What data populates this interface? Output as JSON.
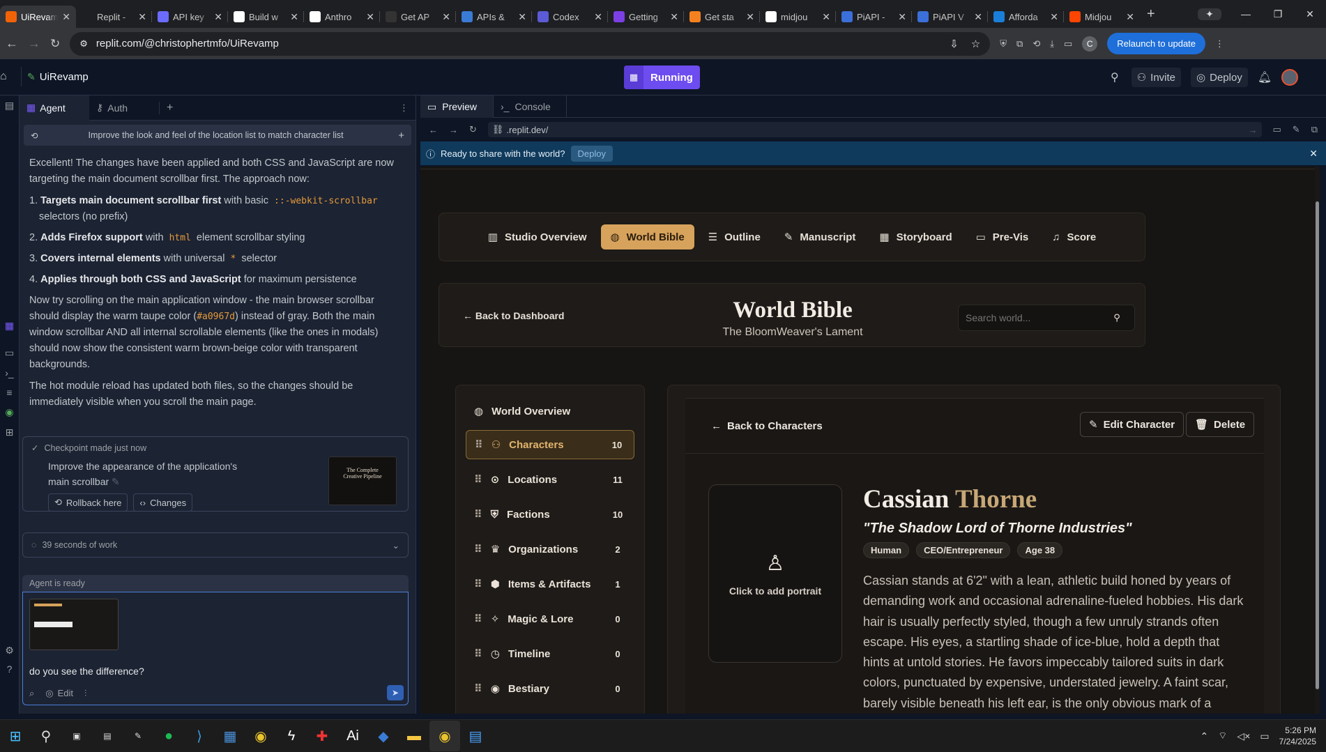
{
  "browser": {
    "tabs": [
      {
        "label": "UiRevamp",
        "icon": "replit-icon",
        "color": "#f26207",
        "active": true
      },
      {
        "label": "Replit - ",
        "icon": "replit-icon",
        "color": "#1e1f22"
      },
      {
        "label": "API key",
        "icon": "openai-icon",
        "color": "#6b6bff"
      },
      {
        "label": "Build w",
        "icon": "anthropic-icon",
        "color": "#ffffff"
      },
      {
        "label": "Anthro",
        "icon": "anthropic-icon",
        "color": "#ffffff"
      },
      {
        "label": "Get AP",
        "icon": "terminal-icon",
        "color": "#333333"
      },
      {
        "label": "APIs &",
        "icon": "api-icon",
        "color": "#3a7bd5"
      },
      {
        "label": "Codex",
        "icon": "codex-icon",
        "color": "#5b5bd6"
      },
      {
        "label": "Getting",
        "icon": "plus-icon",
        "color": "#7b3fe4"
      },
      {
        "label": "Get sta",
        "icon": "cloud-icon",
        "color": "#f48120"
      },
      {
        "label": "midjou",
        "icon": "google-icon",
        "color": "#ffffff"
      },
      {
        "label": "PiAPI - ",
        "icon": "piapi-icon",
        "color": "#3b6fd9"
      },
      {
        "label": "PiAPI V",
        "icon": "piapi-icon",
        "color": "#3b6fd9"
      },
      {
        "label": "Afforda",
        "icon": "t-icon",
        "color": "#1a7fd9"
      },
      {
        "label": "Midjou",
        "icon": "midjourney-icon",
        "color": "#ff4500"
      }
    ],
    "url": "replit.com/@christophertmfo/UiRevamp",
    "relaunch_label": "Relaunch to update",
    "profile_initial": "C"
  },
  "replit": {
    "project_name": "UiRevamp",
    "run_status": "Running",
    "invite_label": "Invite",
    "deploy_label": "Deploy",
    "agent_tabs": [
      "Agent",
      "Auth"
    ],
    "thread_title": "Improve the look and feel of the location list to match character list",
    "messages": {
      "intro": "Excellent! The changes have been applied and both CSS and JavaScript are now targeting the main document scrollbar first. The approach now:",
      "list": [
        {
          "bold": "Targets main document scrollbar first",
          "rest1": " with basic ",
          "code": "::-webkit-scrollbar",
          "rest2": " selectors (no prefix)"
        },
        {
          "bold": "Adds Firefox support",
          "rest1": " with ",
          "code": "html",
          "rest2": " element scrollbar styling"
        },
        {
          "bold": "Covers internal elements",
          "rest1": " with universal ",
          "code": "*",
          "rest2": " selector"
        },
        {
          "bold": "Applies through both CSS and JavaScript",
          "rest1": " for maximum persistence",
          "code": "",
          "rest2": ""
        }
      ],
      "p2a": "Now try scrolling on the main application window - the main browser scrollbar should display the warm taupe color (",
      "p2code": "#a0967d",
      "p2b": ") instead of gray. Both the main window scrollbar AND all internal scrollable elements (like the ones in modals) should now show the consistent warm brown-beige color with transparent backgrounds.",
      "p3": "The hot module reload has updated both files, so the changes should be immediately visible when you scroll the main page."
    },
    "checkpoint": {
      "title": "Checkpoint made just now",
      "desc": "Improve the appearance of the application's main scrollbar",
      "rollback": "Rollback here",
      "changes": "Changes",
      "thumb_title": "The Complete Creative Pipeline"
    },
    "work": "39 seconds of work",
    "agent_status": "Agent is ready",
    "input_text": "do you see the difference?",
    "edit_label": "Edit",
    "preview_tabs": [
      "Preview",
      "Console"
    ],
    "preview_url": ".replit.dev/",
    "share_text": "Ready to share with the world?",
    "share_deploy": "Deploy"
  },
  "app": {
    "nav": [
      "Studio Overview",
      "World Bible",
      "Outline",
      "Manuscript",
      "Storyboard",
      "Pre-Vis",
      "Score"
    ],
    "back_dashboard": "← Back to Dashboard",
    "title": "World Bible",
    "subtitle": "The BloomWeaver's Lament",
    "search_placeholder": "Search world...",
    "overview": "World Overview",
    "categories": [
      {
        "label": "Characters",
        "count": "10",
        "icon": "users-icon"
      },
      {
        "label": "Locations",
        "count": "11",
        "icon": "map-pin-icon"
      },
      {
        "label": "Factions",
        "count": "10",
        "icon": "shield-icon"
      },
      {
        "label": "Organizations",
        "count": "2",
        "icon": "crown-icon"
      },
      {
        "label": "Items & Artifacts",
        "count": "1",
        "icon": "box-icon"
      },
      {
        "label": "Magic & Lore",
        "count": "0",
        "icon": "sparkles-icon"
      },
      {
        "label": "Timeline",
        "count": "0",
        "icon": "clock-icon"
      },
      {
        "label": "Bestiary",
        "count": "0",
        "icon": "eye-icon"
      }
    ],
    "back_characters": "Back to Characters",
    "edit_character": "Edit Character",
    "delete": "Delete",
    "portrait_hint": "Click to add portrait",
    "char_first": "Cassian",
    "char_last": "Thorne",
    "tagline": "\"The Shadow Lord of Thorne Industries\"",
    "tags": [
      "Human",
      "CEO/Entrepreneur",
      "Age 38"
    ],
    "description": "Cassian stands at 6'2\" with a lean, athletic build honed by years of demanding work and occasional adrenaline-fueled hobbies. His dark hair is usually perfectly styled, though a few unruly strands often escape. His eyes, a startling shade of ice-blue, hold a depth that hints at untold stories. He favors impeccably tailored suits in dark colors, punctuated by expensive, understated jewelry. A faint scar, barely visible beneath his left ear, is the only obvious mark of a"
  },
  "taskbar": {
    "time": "5:26 PM",
    "date": "7/24/2025"
  },
  "colors": {
    "accent": "#d6a25c",
    "replit_bg": "#0e1525",
    "running": "#6d4cf0"
  }
}
